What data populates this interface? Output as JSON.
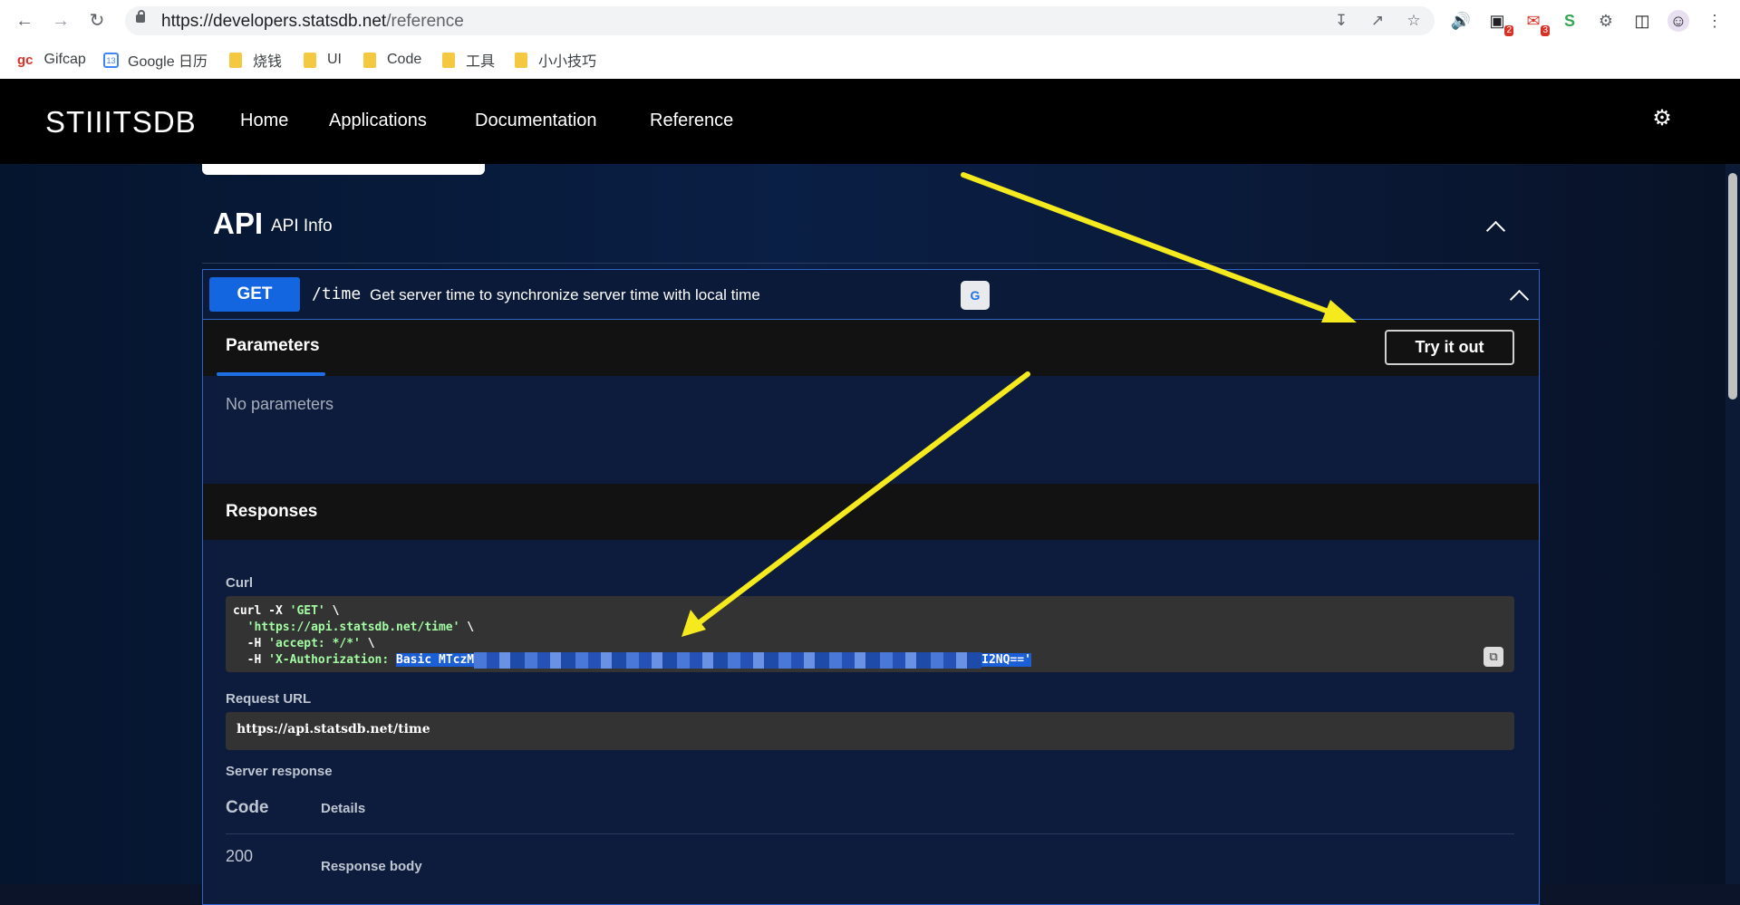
{
  "browser": {
    "url_host": "https://developers.statsdb.net",
    "url_path": "/reference",
    "bookmarks": [
      {
        "label": "Gifcap",
        "icon": "gifcap-icon"
      },
      {
        "label": "Google 日历",
        "icon": "google-calendar-icon"
      },
      {
        "label": "烧钱",
        "icon": "folder-icon"
      },
      {
        "label": "UI",
        "icon": "folder-icon"
      },
      {
        "label": "Code",
        "icon": "folder-icon"
      },
      {
        "label": "工具",
        "icon": "folder-icon"
      },
      {
        "label": "小小技巧",
        "icon": "folder-icon"
      }
    ],
    "extension_badges": {
      "ext1": "2",
      "ext2": "3"
    }
  },
  "site": {
    "logo": "STIIITSDB",
    "nav": [
      "Home",
      "Applications",
      "Documentation",
      "Reference"
    ]
  },
  "api_section": {
    "title": "API",
    "subtitle": "API Info"
  },
  "operation": {
    "method": "GET",
    "path": "/time",
    "summary": "Get server time to synchronize server time with local time",
    "parameters_tab": "Parameters",
    "try_button": "Try it out",
    "no_parameters": "No parameters",
    "responses_title": "Responses",
    "curl_label": "Curl",
    "curl_lines": {
      "l1_cmd": "curl -X ",
      "l1_str": "'GET'",
      "l2_str": "'https://api.statsdb.net/time'",
      "l3_cmd": "  -H ",
      "l3_str": "'accept: */*'",
      "l4_cmd": "  -H ",
      "l4_str": "'X-Authorization: ",
      "l4_hl_start": "Basic MTczM",
      "l4_hl_end": "I2NQ=='"
    },
    "request_url_label": "Request URL",
    "request_url": "https://api.statsdb.net/time",
    "server_response_label": "Server response",
    "code_header": "Code",
    "details_header": "Details",
    "code_value": "200",
    "response_body_label": "Response body"
  },
  "colors": {
    "method_get": "#1466e0",
    "annotation_arrow": "#f4ea1e"
  }
}
